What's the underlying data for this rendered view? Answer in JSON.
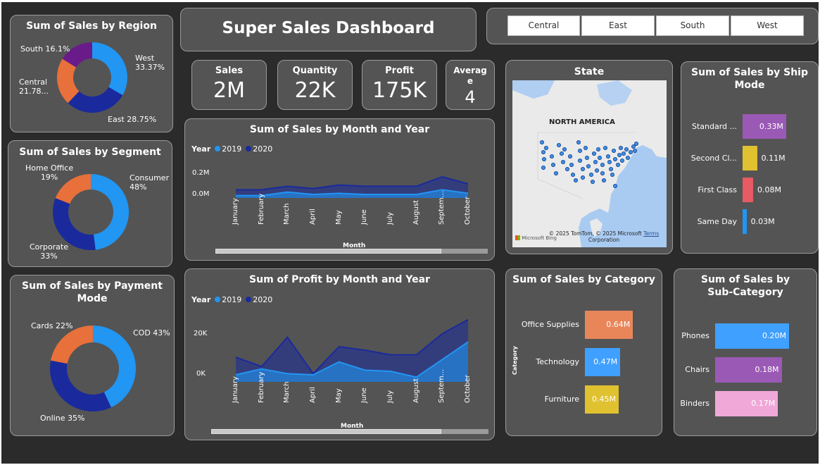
{
  "dashboard_title": "Super Sales Dashboard",
  "region_filter": [
    "Central",
    "East",
    "South",
    "West"
  ],
  "kpis": {
    "sales": {
      "label": "Sales",
      "value": "2M"
    },
    "quantity": {
      "label": "Quantity",
      "value": "22K"
    },
    "profit": {
      "label": "Profit",
      "value": "175K"
    },
    "average": {
      "label_line1": "Averag",
      "label_line2": "e",
      "value": "4"
    }
  },
  "colors": {
    "blue": "#2196f3",
    "navy": "#1a2a9c",
    "orange": "#e8703a",
    "purple": "#6a1b8a",
    "panel": "#545454",
    "background": "#2b2b2b"
  },
  "chart_data": [
    {
      "id": "region",
      "type": "pie",
      "title": "Sum of Sales by Region",
      "slices": [
        {
          "name": "West",
          "value": 33.37,
          "label_line1": "West",
          "label_line2": "33.37%",
          "color": "#2196f3"
        },
        {
          "name": "East",
          "value": 28.75,
          "label_line1": "East 28.75%",
          "label_line2": "",
          "color": "#1a2a9c"
        },
        {
          "name": "Central",
          "value": 21.78,
          "label_line1": "Central",
          "label_line2": "21.78...",
          "color": "#e8703a"
        },
        {
          "name": "South",
          "value": 16.1,
          "label_line1": "South 16.1%",
          "label_line2": "",
          "color": "#6a1b8a"
        }
      ]
    },
    {
      "id": "segment",
      "type": "pie",
      "title": "Sum of Sales by Segment",
      "slices": [
        {
          "name": "Consumer",
          "value": 48,
          "label_line1": "Consumer",
          "label_line2": "48%",
          "color": "#2196f3"
        },
        {
          "name": "Corporate",
          "value": 33,
          "label_line1": "Corporate",
          "label_line2": "33%",
          "color": "#1a2a9c"
        },
        {
          "name": "Home Office",
          "value": 19,
          "label_line1": "Home Office",
          "label_line2": "19%",
          "color": "#e8703a"
        }
      ]
    },
    {
      "id": "payment",
      "type": "pie",
      "title_line1": "Sum of Sales by Payment",
      "title_line2": "Mode",
      "slices": [
        {
          "name": "COD",
          "value": 43,
          "label_line1": "COD 43%",
          "label_line2": "",
          "color": "#2196f3"
        },
        {
          "name": "Online",
          "value": 35,
          "label_line1": "Online 35%",
          "label_line2": "",
          "color": "#1a2a9c"
        },
        {
          "name": "Cards",
          "value": 22,
          "label_line1": "Cards 22%",
          "label_line2": "",
          "color": "#e8703a"
        }
      ]
    },
    {
      "id": "sales_month",
      "type": "area",
      "title": "Sum of Sales by Month and Year",
      "legend_title": "Year",
      "xlabel": "Month",
      "ytick_labels": [
        "0.2M",
        "0.0M"
      ],
      "yticks": [
        0.2,
        0.0
      ],
      "ylim": [
        0,
        0.3
      ],
      "categories": [
        "January",
        "February",
        "March",
        "April",
        "May",
        "June",
        "July",
        "August",
        "Septem...",
        "October"
      ],
      "series": [
        {
          "name": "2020",
          "color": "#1a2a9c",
          "values": [
            0.07,
            0.07,
            0.1,
            0.08,
            0.11,
            0.1,
            0.1,
            0.1,
            0.18,
            0.12
          ]
        },
        {
          "name": "2019",
          "color": "#2196f3",
          "values": [
            0.02,
            0.02,
            0.05,
            0.03,
            0.04,
            0.03,
            0.03,
            0.03,
            0.07,
            0.04
          ]
        }
      ],
      "scroll_fraction": 0.83
    },
    {
      "id": "profit_month",
      "type": "area",
      "title": "Sum of Profit by Month and Year",
      "legend_title": "Year",
      "xlabel": "Month",
      "ytick_labels": [
        "20K",
        "0K"
      ],
      "yticks": [
        20000,
        0
      ],
      "ylim": [
        0,
        30000
      ],
      "categories": [
        "January",
        "February",
        "March",
        "April",
        "May",
        "June",
        "July",
        "August",
        "Septem...",
        "October"
      ],
      "series": [
        {
          "name": "2020",
          "color": "#1a2a9c",
          "values": [
            10500,
            6500,
            19000,
            3500,
            15000,
            13500,
            11500,
            11500,
            20500,
            26500
          ]
        },
        {
          "name": "2019",
          "color": "#2196f3",
          "values": [
            3000,
            5500,
            3500,
            3000,
            8500,
            5000,
            4500,
            2000,
            9500,
            17000
          ]
        }
      ],
      "scroll_fraction": 0.83
    },
    {
      "id": "ship_mode",
      "type": "bar",
      "title_line1": "Sum of Sales by Ship",
      "title_line2": "Mode",
      "xlim": [
        0,
        0.4
      ],
      "bars": [
        {
          "category": "Standard ...",
          "value": 0.33,
          "label": "0.33M",
          "color": "#9b59b6"
        },
        {
          "category": "Second Cl...",
          "value": 0.11,
          "label": "0.11M",
          "color": "#e0c12f"
        },
        {
          "category": "First Class",
          "value": 0.08,
          "label": "0.08M",
          "color": "#e85a64"
        },
        {
          "category": "Same Day",
          "value": 0.03,
          "label": "0.03M",
          "color": "#2196f3"
        }
      ]
    },
    {
      "id": "category",
      "type": "bar",
      "title": "Sum of Sales by Category",
      "ylabel": "Category",
      "xlim": [
        0,
        0.75
      ],
      "bars": [
        {
          "category": "Office Supplies",
          "value": 0.64,
          "label": "0.64M",
          "color": "#e8865a"
        },
        {
          "category": "Technology",
          "value": 0.47,
          "label": "0.47M",
          "color": "#3fa0ff"
        },
        {
          "category": "Furniture",
          "value": 0.45,
          "label": "0.45M",
          "color": "#e0c12f"
        }
      ]
    },
    {
      "id": "subcategory",
      "type": "bar",
      "title_line1": "Sum of Sales by",
      "title_line2": "Sub-Category",
      "xlim": [
        0,
        0.2
      ],
      "bars": [
        {
          "category": "Phones",
          "value": 0.2,
          "label": "0.20M",
          "color": "#3fa0ff"
        },
        {
          "category": "Chairs",
          "value": 0.18,
          "label": "0.18M",
          "color": "#9b59b6"
        },
        {
          "category": "Binders",
          "value": 0.17,
          "label": "0.17M",
          "color": "#f0a8d8"
        }
      ]
    }
  ],
  "map": {
    "title": "State",
    "region_label": "NORTH AMERICA",
    "attribution_line1": "© 2025 TomTom, © 2025 Microsoft",
    "attribution_line2": "Corporation",
    "terms": "Terms",
    "logo": "Microsoft Bing"
  }
}
